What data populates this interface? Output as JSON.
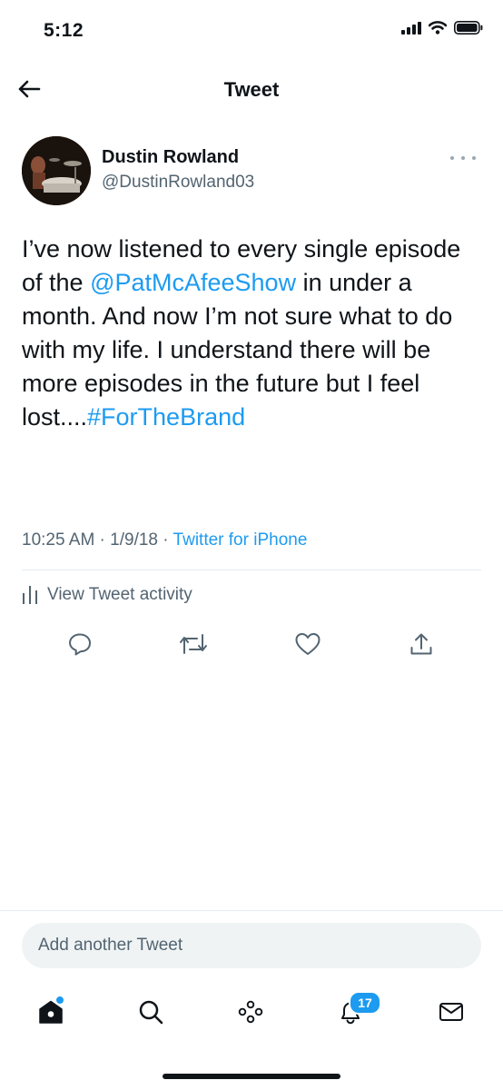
{
  "status_bar": {
    "time": "5:12",
    "icons": [
      "signal-icon",
      "wifi-icon",
      "battery-icon"
    ]
  },
  "nav": {
    "title": "Tweet",
    "back_icon": "back-arrow-icon"
  },
  "tweet": {
    "author_name": "Dustin Rowland",
    "author_handle": "@DustinRowland03",
    "more_icon": "more-icon",
    "text_before_mention": "I’ve now listened to every single episode of the ",
    "mention": "@PatMcAfeeShow",
    "text_after_mention": " in under a month. And now I’m not sure what to do with my life. I understand there will be more episodes in the future but I feel lost....",
    "hashtag": "#ForTheBrand",
    "time": "10:25 AM",
    "separator": " · ",
    "date": "1/9/18",
    "source": "Twitter for iPhone",
    "activity_label": "View Tweet activity"
  },
  "actions": [
    "reply-icon",
    "retweet-icon",
    "like-icon",
    "share-icon"
  ],
  "compose": {
    "placeholder": "Add another Tweet"
  },
  "tabbar": {
    "items": [
      "home-icon",
      "search-icon",
      "spaces-icon",
      "notifications-icon",
      "messages-icon"
    ],
    "notifications_count": "17"
  },
  "colors": {
    "accent": "#1d9bf0",
    "text": "#0f1419",
    "secondary": "#536471",
    "divider": "#e6ecf0"
  }
}
